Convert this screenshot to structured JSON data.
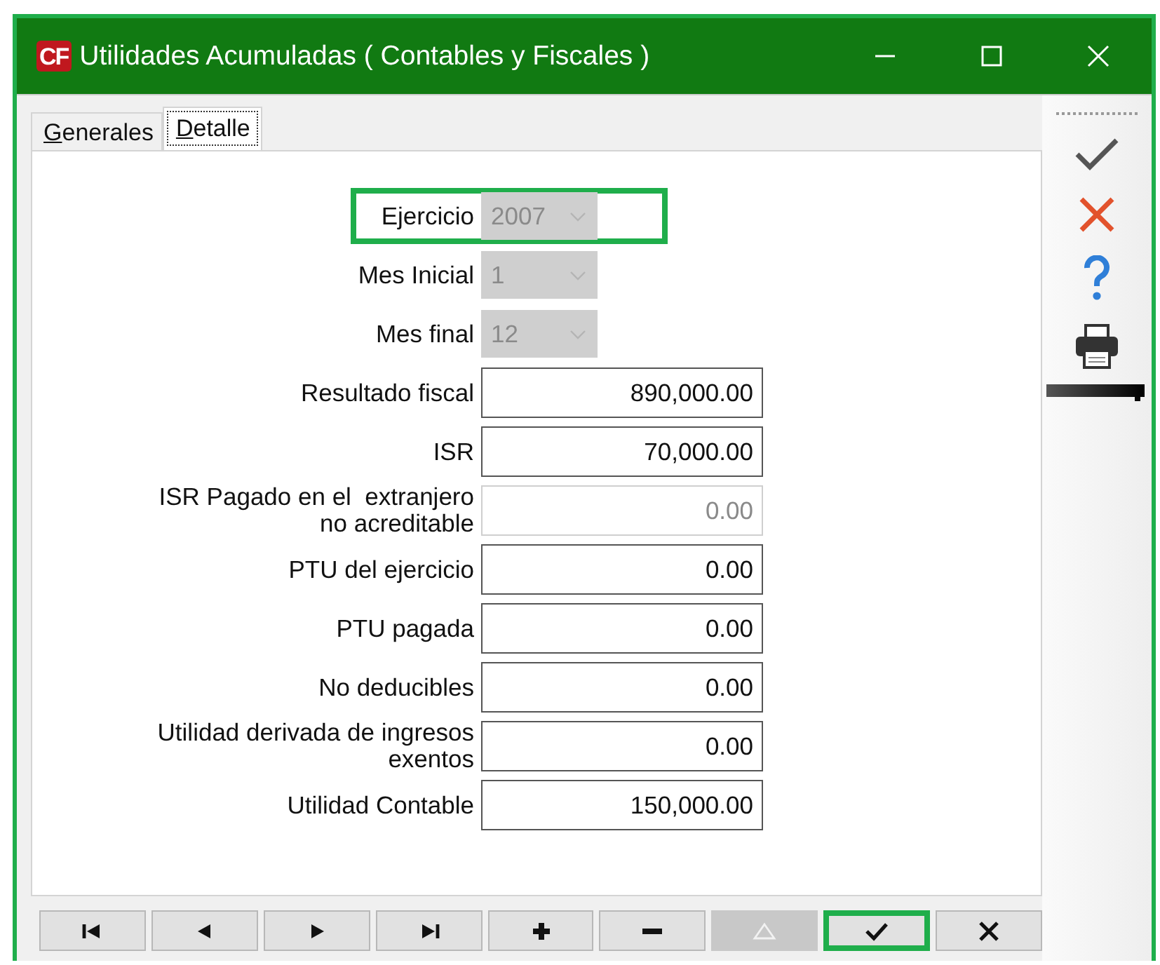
{
  "window": {
    "logo": "CF",
    "title": "Utilidades Acumuladas ( Contables y Fiscales )"
  },
  "tabs": [
    {
      "label": "Generales",
      "selected": false
    },
    {
      "label": "Detalle",
      "selected": true
    }
  ],
  "fields": [
    {
      "kind": "combo",
      "label": "Ejercicio",
      "value": "2007",
      "disabled": true,
      "highlighted": true
    },
    {
      "kind": "combo",
      "label": "Mes Inicial",
      "value": "1",
      "disabled": true,
      "highlighted": false
    },
    {
      "kind": "combo",
      "label": "Mes final",
      "value": "12",
      "disabled": true,
      "highlighted": false
    },
    {
      "kind": "number",
      "label": "Resultado fiscal",
      "value": "890,000.00",
      "disabled": false,
      "highlighted": false
    },
    {
      "kind": "number",
      "label": "ISR",
      "value": "70,000.00",
      "disabled": false,
      "highlighted": false
    },
    {
      "kind": "number",
      "label": "ISR Pagado en el  extranjero no acreditable",
      "value": "0.00",
      "disabled": true,
      "highlighted": false
    },
    {
      "kind": "number",
      "label": "PTU del ejercicio",
      "value": "0.00",
      "disabled": false,
      "highlighted": false
    },
    {
      "kind": "number",
      "label": "PTU pagada",
      "value": "0.00",
      "disabled": false,
      "highlighted": false
    },
    {
      "kind": "number",
      "label": "No deducibles",
      "value": "0.00",
      "disabled": false,
      "highlighted": false
    },
    {
      "kind": "number",
      "label": "Utilidad derivada de ingresos exentos",
      "value": "0.00",
      "disabled": false,
      "highlighted": false
    },
    {
      "kind": "number",
      "label": "Utilidad Contable",
      "value": "150,000.00",
      "disabled": false,
      "highlighted": false
    }
  ],
  "side_toolbar": [
    {
      "kind": "accept"
    },
    {
      "kind": "cancel"
    },
    {
      "kind": "help"
    },
    {
      "kind": "print"
    },
    {
      "kind": "bar"
    }
  ],
  "navigator": [
    {
      "kind": "first",
      "disabled": false,
      "highlighted": false
    },
    {
      "kind": "prev",
      "disabled": false,
      "highlighted": false
    },
    {
      "kind": "next",
      "disabled": false,
      "highlighted": false
    },
    {
      "kind": "last",
      "disabled": false,
      "highlighted": false
    },
    {
      "kind": "add",
      "disabled": false,
      "highlighted": false
    },
    {
      "kind": "remove",
      "disabled": false,
      "highlighted": false
    },
    {
      "kind": "edit",
      "disabled": true,
      "highlighted": false
    },
    {
      "kind": "post",
      "disabled": false,
      "highlighted": true
    },
    {
      "kind": "cancel",
      "disabled": false,
      "highlighted": false
    }
  ]
}
